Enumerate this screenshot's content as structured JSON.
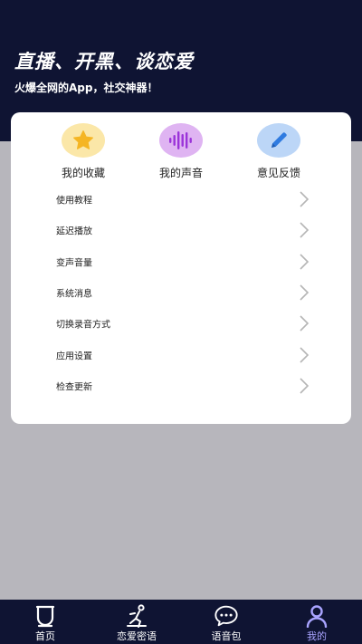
{
  "header": {
    "headline": "直播、开黑、谈恋爱",
    "tagline": "火爆全网的App，社交神器！",
    "background": "#0f1433"
  },
  "quick_actions": [
    {
      "label": "我的收藏",
      "icon": "star-icon",
      "color": "#fbe7a8"
    },
    {
      "label": "我的声音",
      "icon": "soundwave-icon",
      "color": "#dfb4f2"
    },
    {
      "label": "意见反馈",
      "icon": "pencil-icon",
      "color": "#bcd6f7"
    }
  ],
  "menu": [
    {
      "label": "使用教程"
    },
    {
      "label": "延迟播放"
    },
    {
      "label": "变声音量"
    },
    {
      "label": "系统消息"
    },
    {
      "label": "切换录音方式"
    },
    {
      "label": "应用设置"
    },
    {
      "label": "检查更新"
    }
  ],
  "tabs": [
    {
      "label": "首页",
      "icon": "home-icon"
    },
    {
      "label": "恋爱密语",
      "icon": "running-person-icon"
    },
    {
      "label": "语音包",
      "icon": "chat-bubble-icon"
    },
    {
      "label": "我的",
      "icon": "profile-icon",
      "active": true
    }
  ],
  "colors": {
    "accent": "#a9a4ff",
    "page_background": "#b7b6bc"
  }
}
